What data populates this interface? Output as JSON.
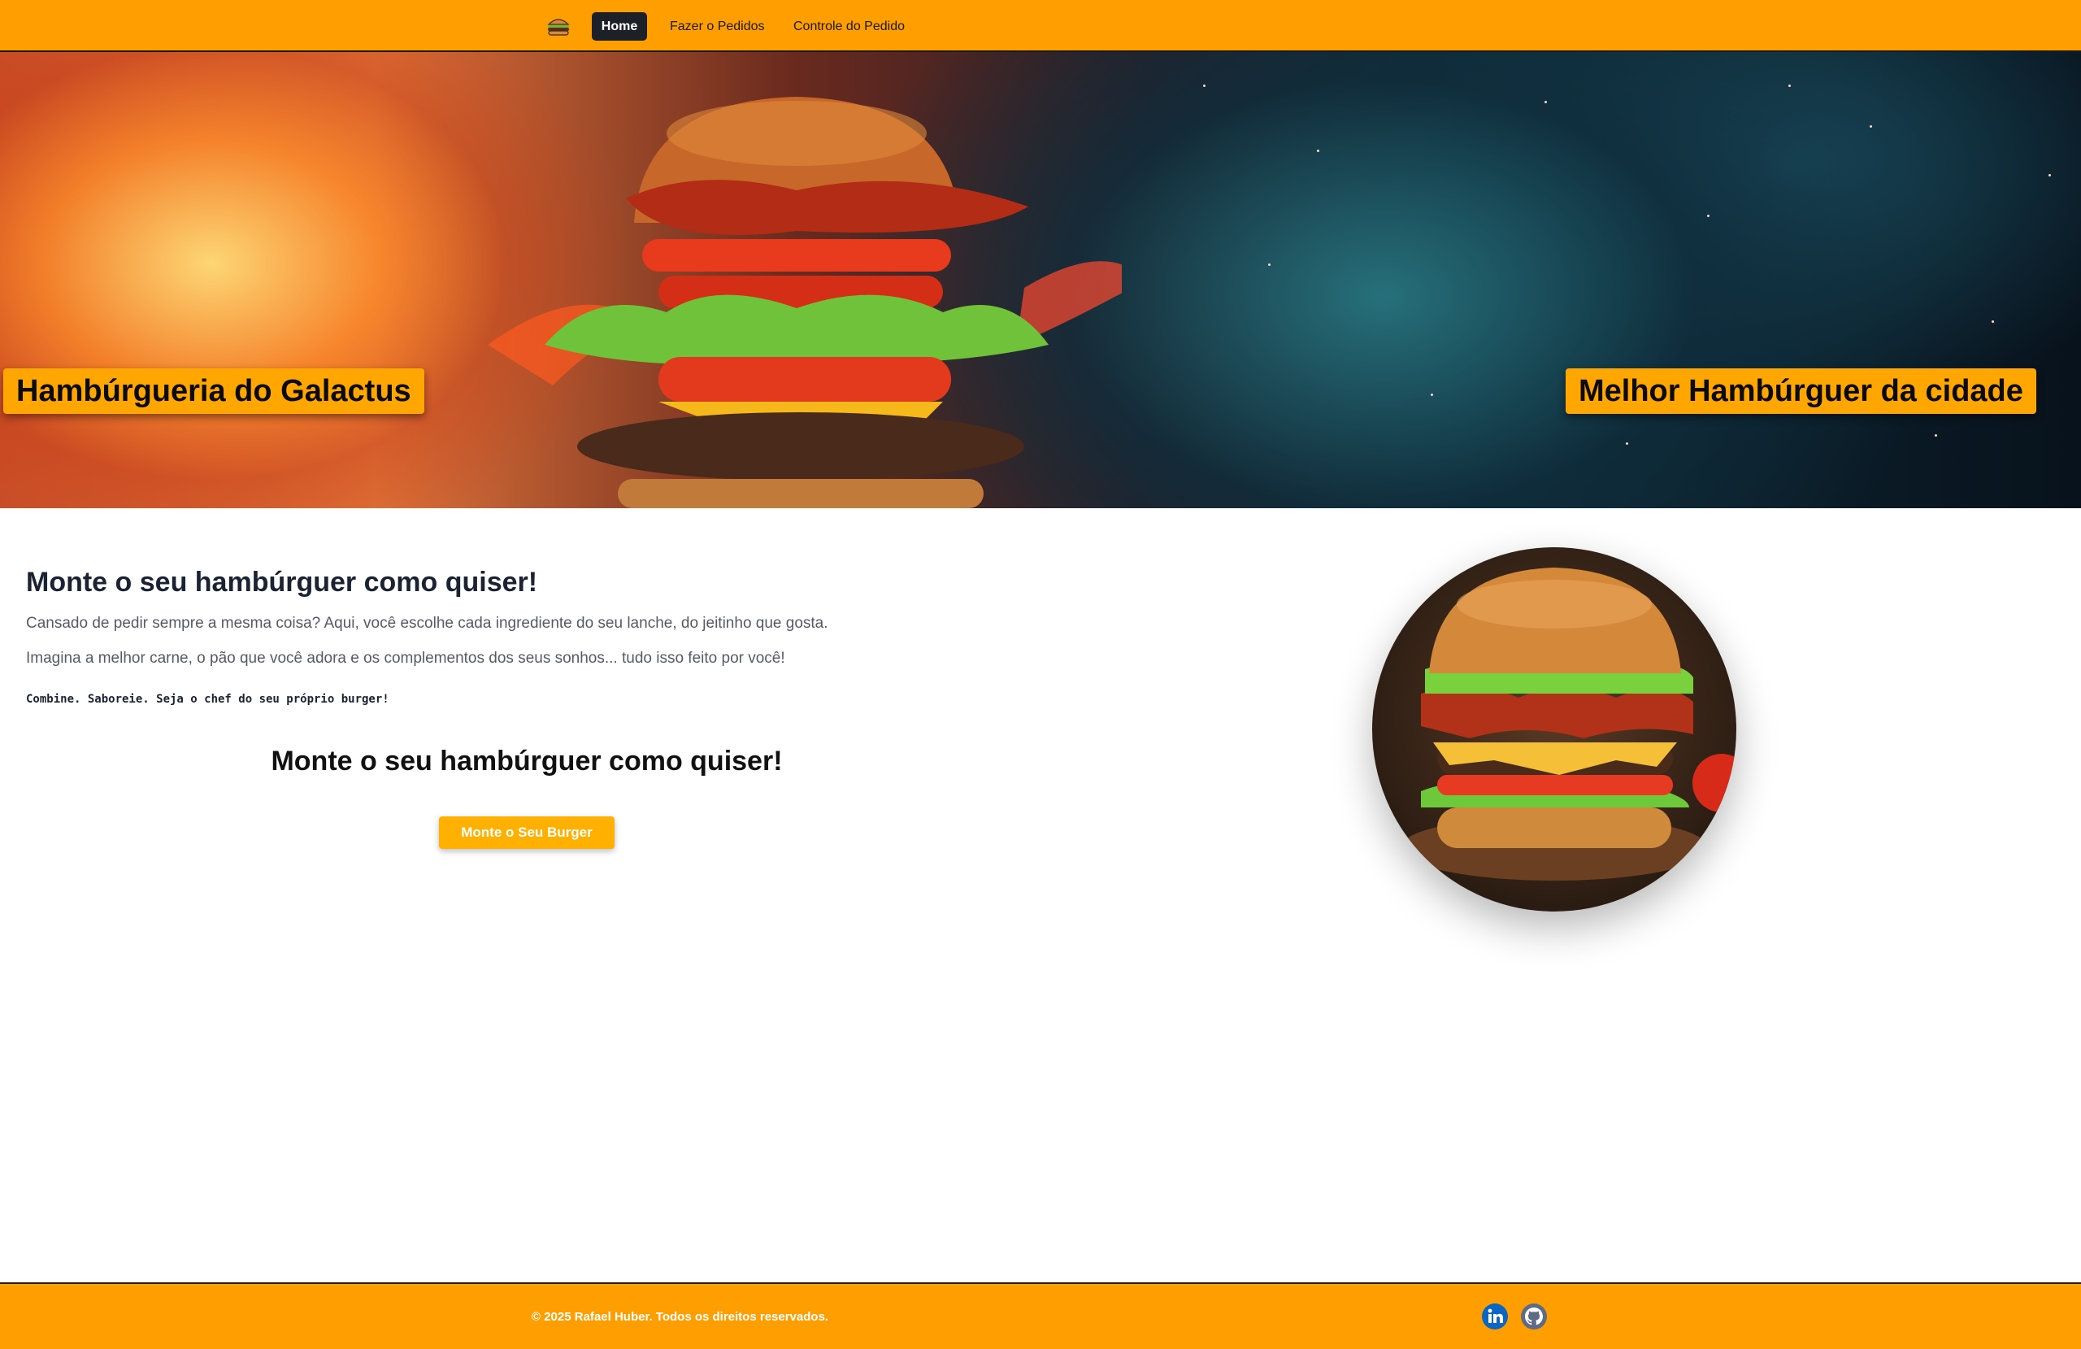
{
  "nav": {
    "logo_icon": "burger-logo-icon",
    "items": [
      {
        "label": "Home",
        "active": true
      },
      {
        "label": "Fazer o Pedidos",
        "active": false
      },
      {
        "label": "Controle do Pedido",
        "active": false
      }
    ]
  },
  "hero": {
    "left_label": "Hambúrgueria do Galactus",
    "right_label": "Melhor Hambúrguer da cidade"
  },
  "main": {
    "title": "Monte o seu hambúrguer como quiser!",
    "paragraph_1": "Cansado de pedir sempre a mesma coisa? Aqui, você escolhe cada ingrediente do seu lanche, do jeitinho que gosta.",
    "paragraph_2": "Imagina a melhor carne, o pão que você adora e os complementos dos seus sonhos... tudo isso feito por você!",
    "tagline": "Combine. Saboreie. Seja o chef do seu próprio burger!",
    "subtitle": "Monte o seu hambúrguer como quiser!",
    "cta_label": "Monte o Seu Burger"
  },
  "footer": {
    "copyright": "© 2025 Rafael Huber. Todos os direitos reservados.",
    "social": [
      "linkedin-icon",
      "github-icon"
    ]
  },
  "colors": {
    "brand_orange": "#ff9e00",
    "cta_yellow": "#ffb000",
    "nav_active": "#1d2026"
  }
}
